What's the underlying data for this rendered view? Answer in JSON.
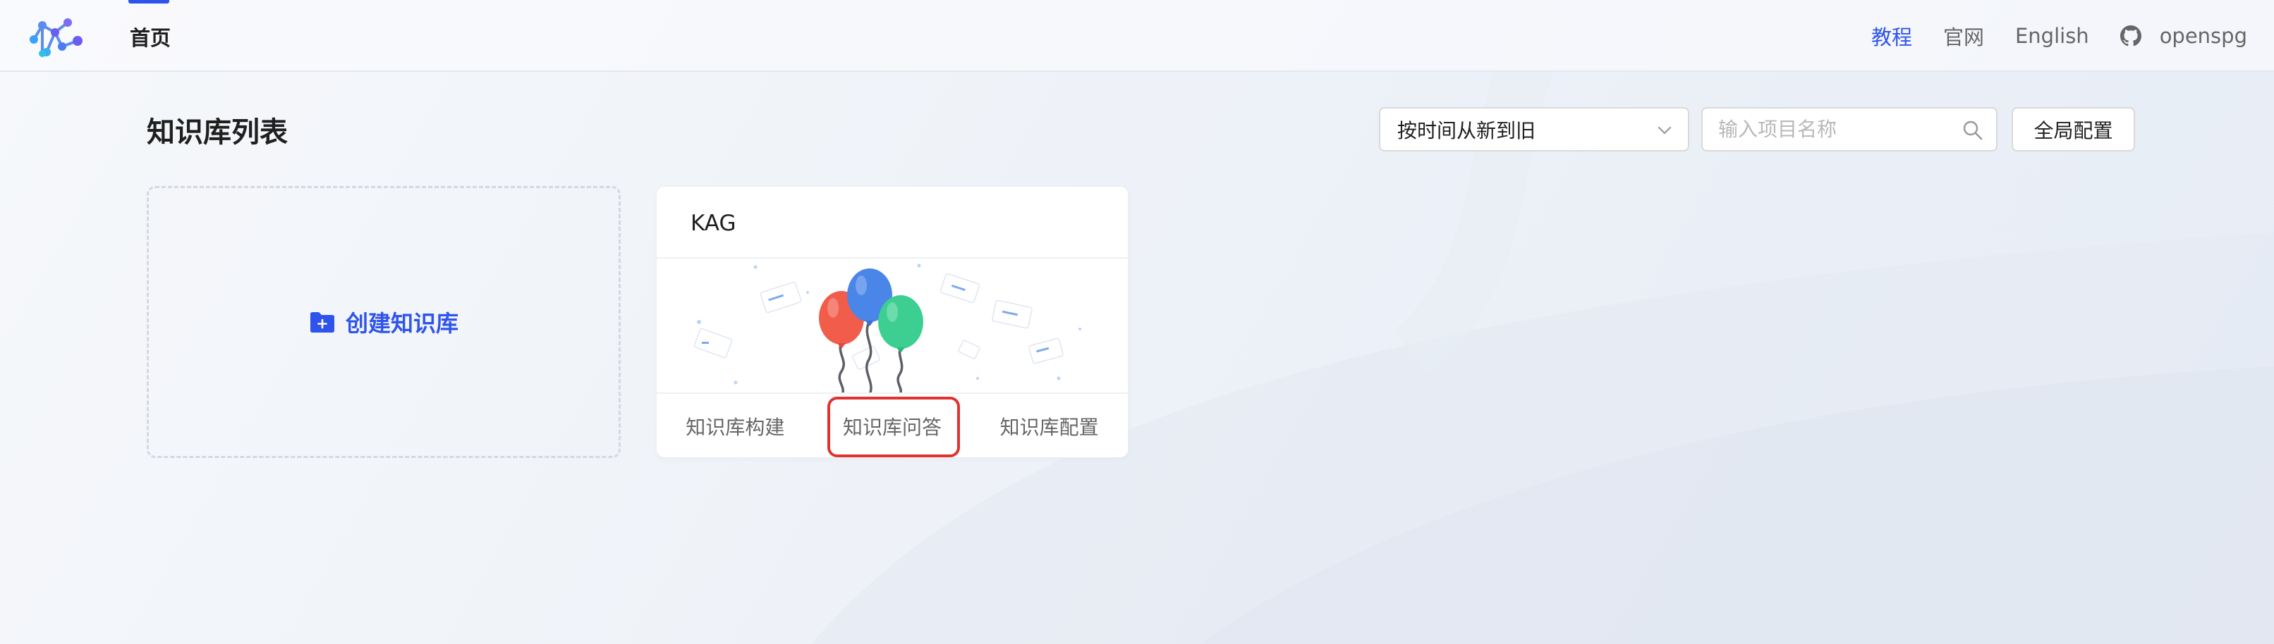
{
  "header": {
    "home": "首页",
    "links": {
      "tutorial": "教程",
      "official": "官网",
      "english": "English",
      "user": "openspg"
    },
    "icons": {
      "logo": "openspg-logo",
      "github": "github-icon"
    }
  },
  "page": {
    "title": "知识库列表",
    "sort": {
      "value": "按时间从新到旧"
    },
    "search": {
      "placeholder": "输入项目名称",
      "value": ""
    },
    "global_config": "全局配置"
  },
  "create_card": {
    "label": "创建知识库"
  },
  "kb_cards": [
    {
      "title": "KAG",
      "actions": [
        "知识库构建",
        "知识库问答",
        "知识库配置"
      ],
      "highlighted_action": "知识库问答"
    }
  ],
  "colors": {
    "accent": "#2f54eb",
    "highlight_border": "#e0332e",
    "balloon_red": "#f25c4b",
    "balloon_blue": "#4a86e8",
    "balloon_green": "#3ccf91"
  }
}
